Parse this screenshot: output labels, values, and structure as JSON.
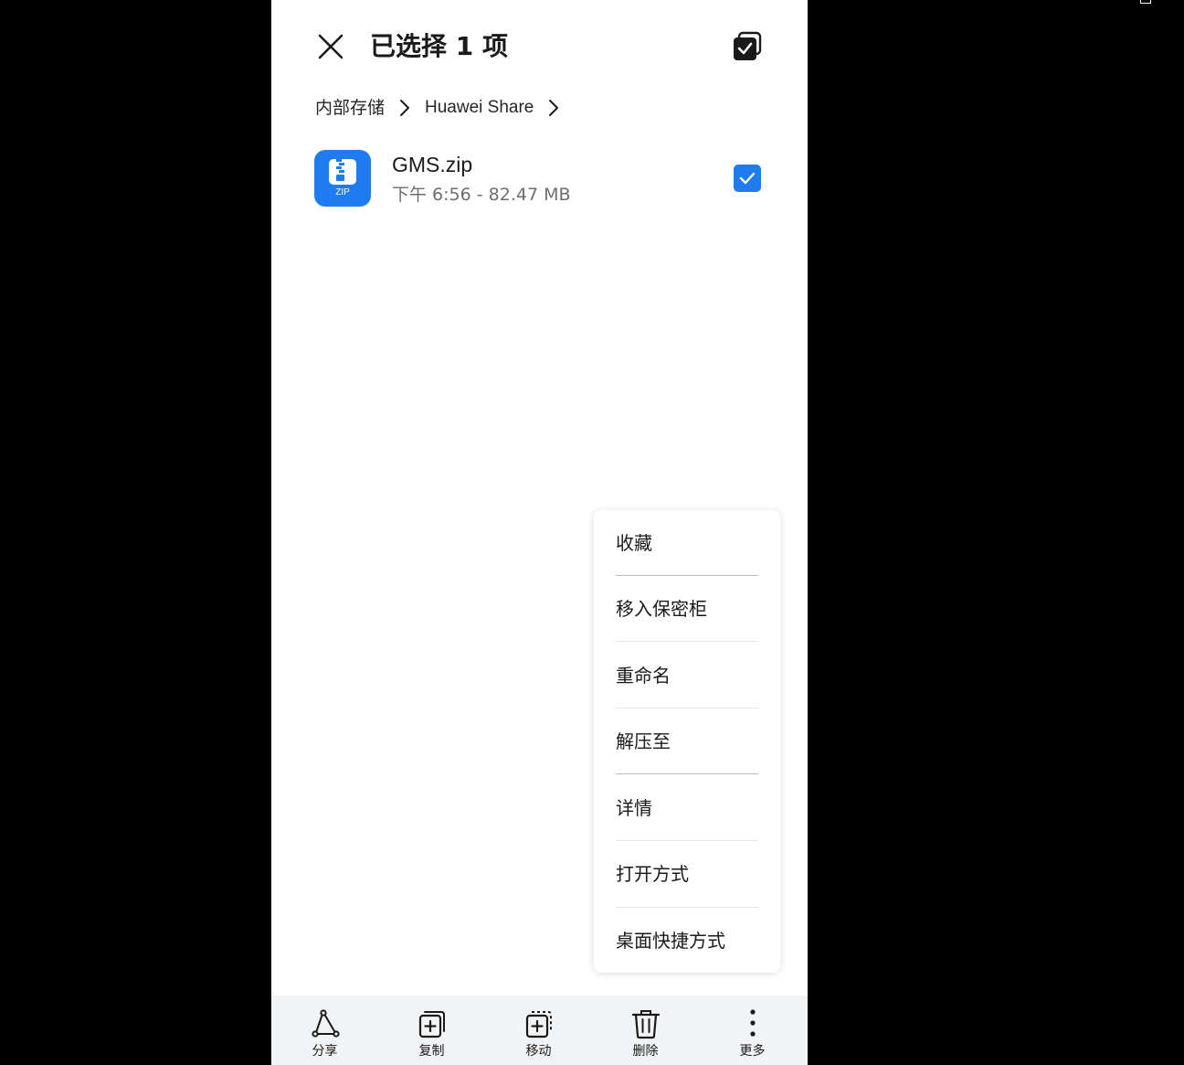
{
  "header": {
    "title": "已选择 1 项",
    "close_icon": "close-icon",
    "select_all_icon": "select-all-checkbox-icon"
  },
  "breadcrumb": {
    "items": [
      "内部存储",
      "Huawei Share"
    ]
  },
  "file": {
    "name": "GMS.zip",
    "meta": "下午 6:56 - 82.47 MB",
    "icon_label": "ZIP",
    "checked": true
  },
  "menu": {
    "items": [
      "收藏",
      "移入保密柜",
      "重命名",
      "解压至",
      "详情",
      "打开方式",
      "桌面快捷方式"
    ]
  },
  "toolbar": {
    "share": "分享",
    "copy": "复制",
    "move": "移动",
    "delete": "删除",
    "more": "更多"
  },
  "colors": {
    "accent": "#1f7cf0",
    "background": "#ffffff",
    "toolbar_bg": "#f1f3f5",
    "outer": "#000000"
  }
}
